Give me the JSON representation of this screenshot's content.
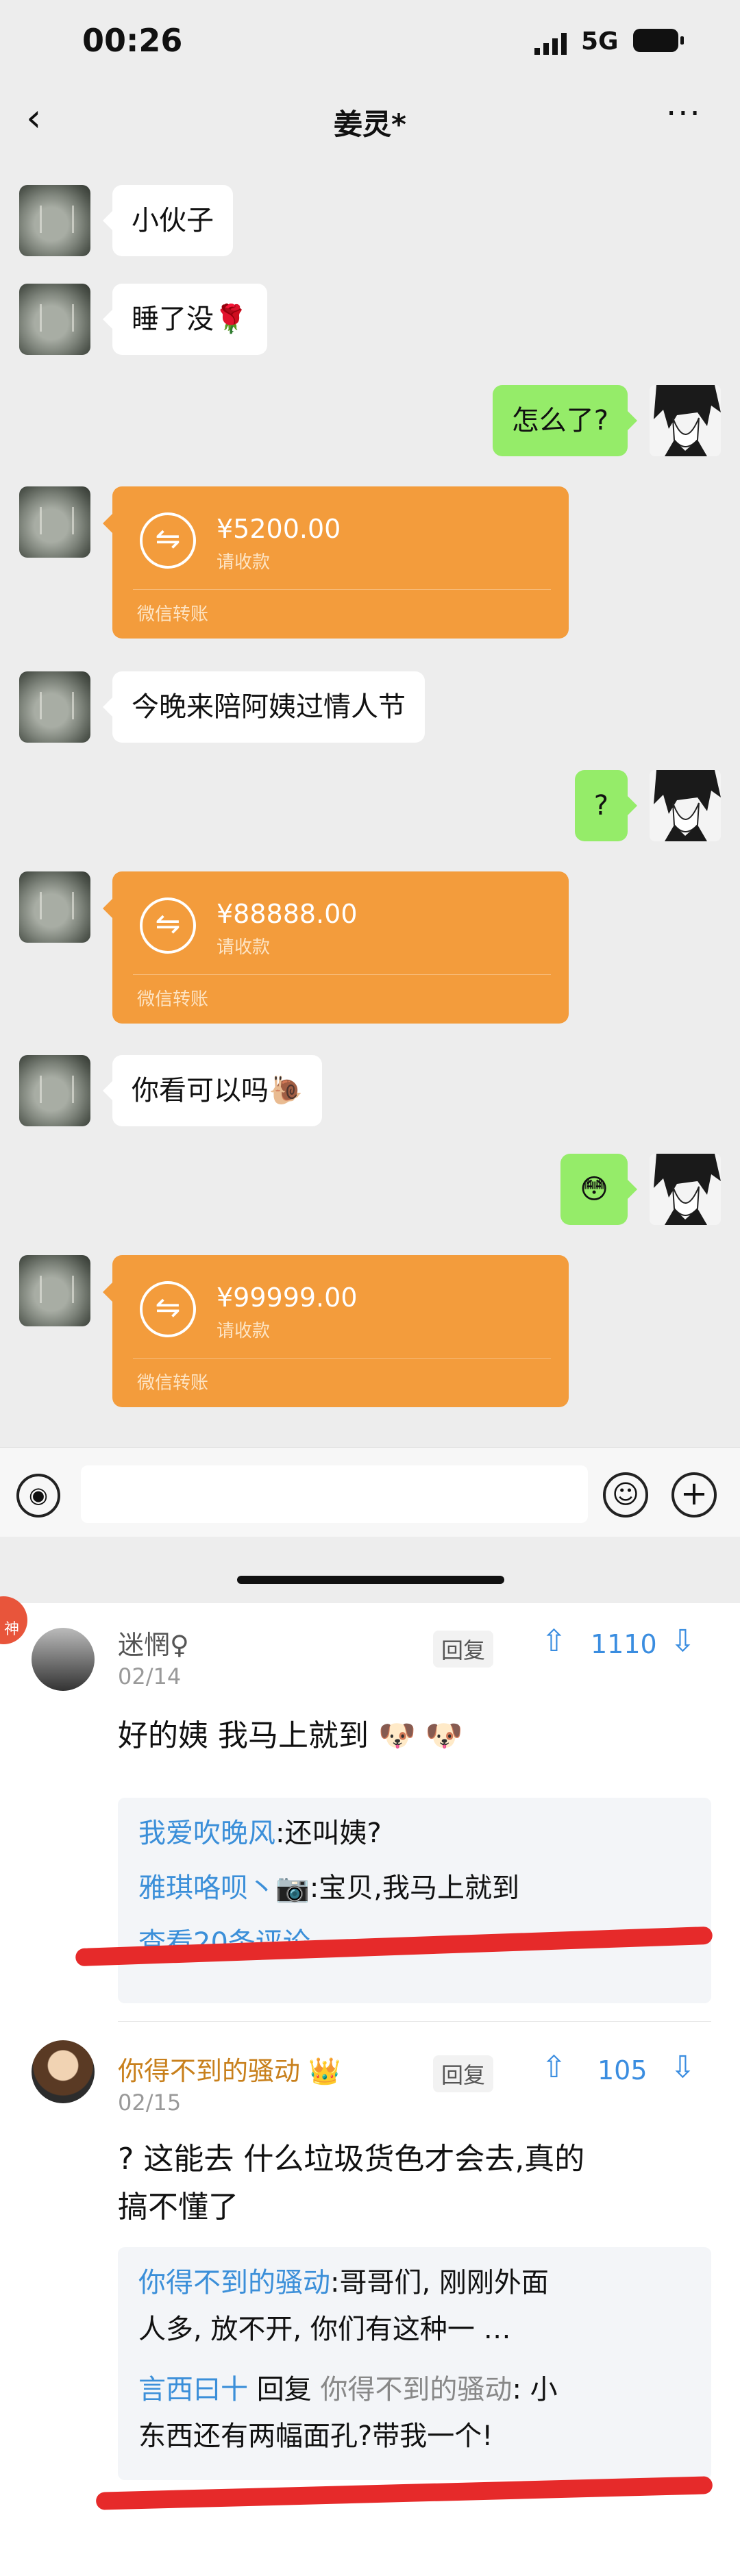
{
  "status": {
    "time": "00:26",
    "network": "5G"
  },
  "nav": {
    "title": "姜灵*",
    "back": "‹",
    "more": "···"
  },
  "messages": [
    {
      "from": "other",
      "type": "text",
      "text": "小伙子"
    },
    {
      "from": "other",
      "type": "text",
      "text": "睡了没",
      "emoji": "🌹"
    },
    {
      "from": "self",
      "type": "text",
      "text": "怎么了?"
    },
    {
      "from": "other",
      "type": "transfer",
      "amount": "¥5200.00",
      "sub": "请收款",
      "footer": "微信转账"
    },
    {
      "from": "other",
      "type": "text",
      "text": "今晚来陪阿姨过情人节"
    },
    {
      "from": "self",
      "type": "text",
      "text": "?"
    },
    {
      "from": "other",
      "type": "transfer",
      "amount": "¥88888.00",
      "sub": "请收款",
      "footer": "微信转账"
    },
    {
      "from": "other",
      "type": "text",
      "text": "你看可以吗",
      "emoji": "🐌"
    },
    {
      "from": "self",
      "type": "text",
      "text": "😳"
    },
    {
      "from": "other",
      "type": "transfer",
      "amount": "¥99999.00",
      "sub": "请收款",
      "footer": "微信转账"
    }
  ],
  "input_bar": {
    "voice_icon": "voice-icon",
    "emoji_icon": "emoji-icon",
    "plus_icon": "plus-icon"
  },
  "comments": [
    {
      "pin": "神",
      "user": "迷惘♀",
      "date": "02/14",
      "reply_label": "回复",
      "votes": "1110",
      "text": "好的姨  我马上就到 🐶 🐶",
      "replies": [
        {
          "user": "我爱吹晚风",
          "text": ":还叫姨?"
        },
        {
          "user": "雅琪咯呗丶📷",
          "text": ":宝贝,我马上就到"
        }
      ],
      "more": "查看20条评论"
    },
    {
      "user": "你得不到的骚动 👑",
      "date": "02/15",
      "reply_label": "回复",
      "votes": "105",
      "text_lines": [
        "? 这能去 什么垃圾货色才会去,真的",
        "搞不懂了"
      ],
      "replies": [
        {
          "user": "你得不到的骚动",
          "text": ":哥哥们, 刚刚外面",
          "cont": "人多, 放不开, 你们有这种一 …"
        },
        {
          "user": "言西曰十",
          "reply_word": "回复",
          "to": "你得不到的骚动",
          "text": ": 小",
          "cont": "东西还有两幅面孔?带我一个!"
        }
      ]
    }
  ]
}
